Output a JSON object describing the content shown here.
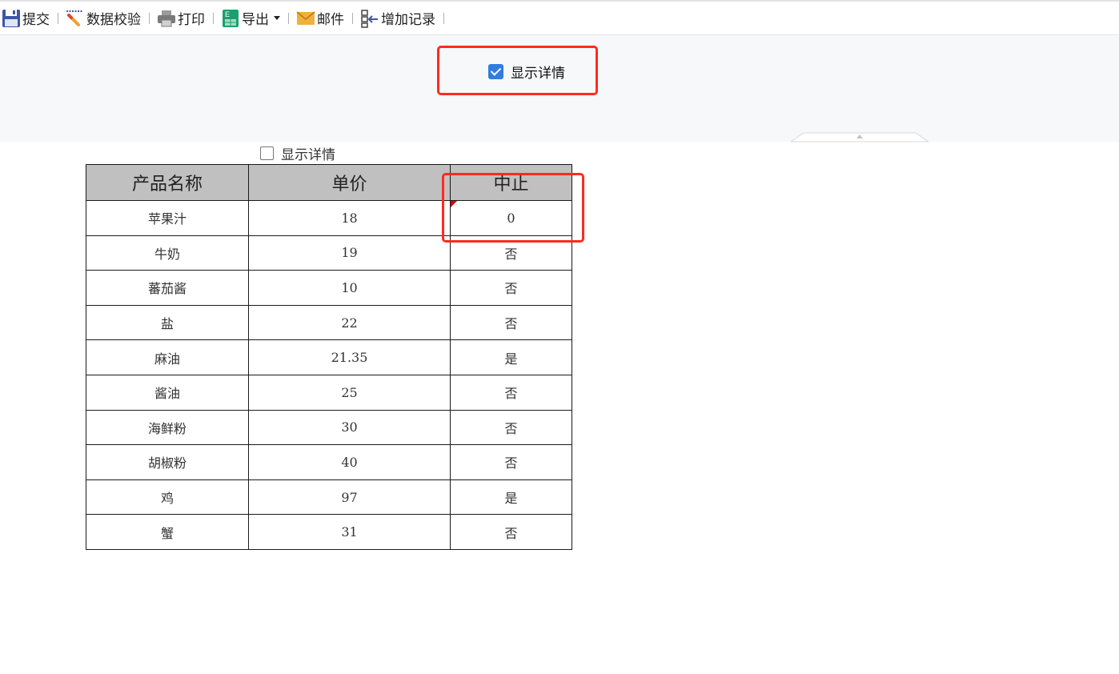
{
  "toolbar": {
    "buttons": [
      {
        "label": "提交",
        "icon": "save-icon"
      },
      {
        "label": "数据校验",
        "icon": "validate-icon"
      },
      {
        "label": "打印",
        "icon": "printer-icon"
      },
      {
        "label": "导出",
        "icon": "excel-export-icon",
        "has_dropdown": true
      },
      {
        "label": "邮件",
        "icon": "envelope-icon"
      },
      {
        "label": "增加记录",
        "icon": "add-record-icon"
      }
    ]
  },
  "parameter_pane": {
    "show_details_label": "显示详情",
    "show_details_checked": true
  },
  "report": {
    "show_details_label": "显示详情",
    "show_details_checked": false,
    "columns": [
      "产品名称",
      "单价",
      "中止"
    ],
    "rows": [
      [
        "苹果汁",
        "18",
        "0"
      ],
      [
        "牛奶",
        "19",
        "否"
      ],
      [
        "蕃茄酱",
        "10",
        "否"
      ],
      [
        "盐",
        "22",
        "否"
      ],
      [
        "麻油",
        "21.35",
        "是"
      ],
      [
        "酱油",
        "25",
        "否"
      ],
      [
        "海鲜粉",
        "30",
        "否"
      ],
      [
        "胡椒粉",
        "40",
        "否"
      ],
      [
        "鸡",
        "97",
        "是"
      ],
      [
        "蟹",
        "31",
        "否"
      ]
    ]
  },
  "colors": {
    "annotation": "#ff2a1f",
    "checkbox_accent": "#2f7de1",
    "header_bg": "#c0c0c0",
    "param_bg": "#f7f8fa",
    "flag": "#d8000c"
  }
}
